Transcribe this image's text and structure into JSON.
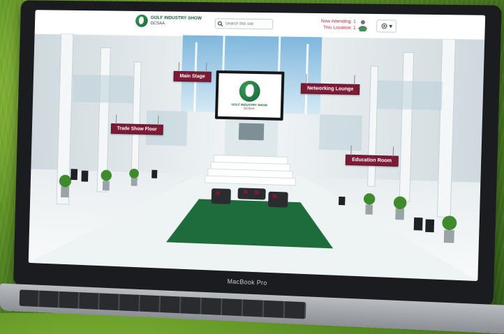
{
  "header": {
    "logo_title": "GOLF INDUSTRY SHOW",
    "logo_subtitle": "GCSAA",
    "search_placeholder": "Search this site",
    "now_attending_label": "Now Attending:",
    "now_attending_value": "1",
    "this_location_label": "This Location:",
    "this_location_value": "1",
    "settings_caret": "▾"
  },
  "signs": {
    "main_stage": "Main Stage",
    "networking_lounge": "Networking Lounge",
    "trade_show_floor": "Trade Show Floor",
    "education_room": "Education Room"
  },
  "display": {
    "title": "GOLF INDUSTRY SHOW",
    "subtitle": "GCSAA"
  },
  "device": {
    "label": "MacBook Pro"
  },
  "colors": {
    "brand_green": "#16603a",
    "sign_maroon": "#7d1b37",
    "carpet_green": "#1e6b3c"
  }
}
